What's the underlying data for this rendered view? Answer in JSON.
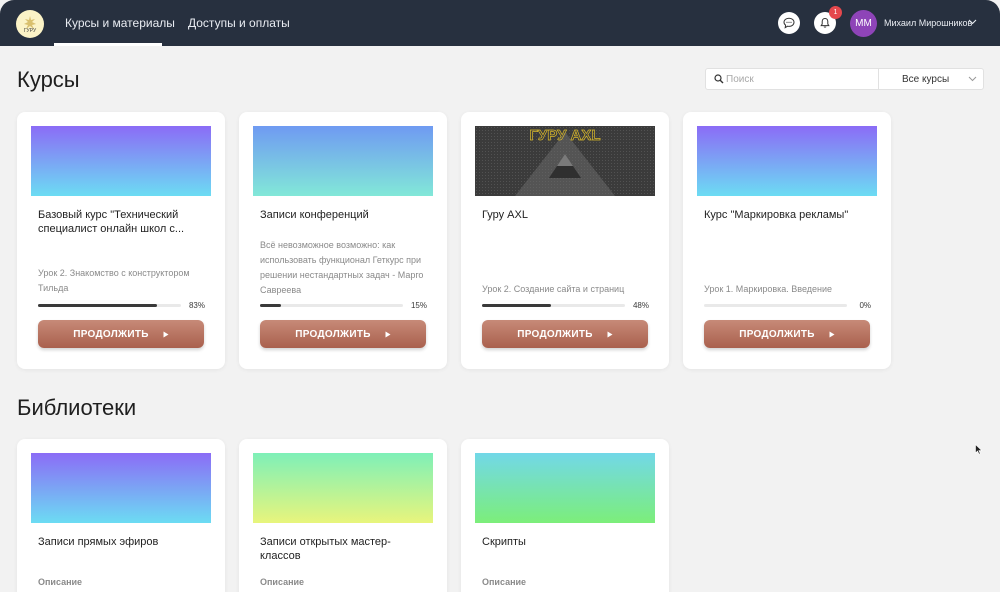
{
  "logo": {
    "text": "ГУРУ"
  },
  "nav": {
    "items": [
      {
        "label": "Курсы и материалы",
        "active": true
      },
      {
        "label": "Доступы и оплаты",
        "active": false
      }
    ]
  },
  "header": {
    "chat_icon": "chat-bubble-icon",
    "bell_icon": "bell-icon",
    "notifications_count": "1",
    "user": {
      "initials": "ММ",
      "name": "Михаил Мирошников"
    }
  },
  "courses": {
    "title": "Курсы",
    "search": {
      "placeholder": "Поиск",
      "value": ""
    },
    "filter": {
      "selected": "Все курсы"
    },
    "items": [
      {
        "title": "Базовый курс \"Технический специалист онлайн школ с...",
        "description": "",
        "lesson": "Урок 2. Знакомство с конструктором Тильда",
        "progress": 0.83,
        "progress_label": "83%",
        "button": "ПРОДОЛЖИТЬ",
        "cover": [
          "#8b6cf6",
          "#6cdcf3"
        ]
      },
      {
        "title": "Записи конференций",
        "description": "Всё невозможное возможно: как использовать функционал Геткурс при решении нестандартных задач - Марго Савреева",
        "lesson": "",
        "progress": 0.15,
        "progress_label": "15%",
        "button": "ПРОДОЛЖИТЬ",
        "cover": [
          "#6f9af2",
          "#82e8d8"
        ]
      },
      {
        "title": "Гуру AXL",
        "description": "",
        "lesson": "Урок 2. Создание сайта и страниц",
        "progress": 0.48,
        "progress_label": "48%",
        "button": "ПРОДОЛЖИТЬ",
        "cover_logo": "ГУРУ AXL"
      },
      {
        "title": "Курс \"Маркировка рекламы\"",
        "description": "",
        "lesson": "Урок 1. Маркировка. Введение",
        "progress": 0.0,
        "progress_label": "0%",
        "button": "ПРОДОЛЖИТЬ",
        "cover": [
          "#8b6cf6",
          "#6cdcf3"
        ]
      }
    ]
  },
  "libraries": {
    "title": "Библиотеки",
    "items": [
      {
        "title": "Записи прямых эфиров",
        "desc_label": "Описание",
        "cover": [
          "#8b6cf6",
          "#6cdcf3"
        ]
      },
      {
        "title": "Записи открытых мастер-классов",
        "desc_label": "Описание",
        "cover": [
          "#7ef0b8",
          "#e8f57c"
        ]
      },
      {
        "title": "Скрипты",
        "desc_label": "Описание",
        "cover": [
          "#72d8e8",
          "#7cee7a"
        ]
      }
    ]
  }
}
